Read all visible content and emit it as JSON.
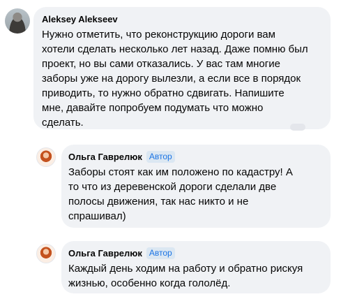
{
  "main_comment": {
    "author": "Aleksey Alekseev",
    "lines": [
      "Нужно отметить, что реконструкцию дороги вам",
      "хотели сделать несколько лет назад. Даже помню был",
      "проект, но вы сами отказались. У вас там многие",
      "заборы уже на дорогу вылезли, а если все в порядок",
      "приводить, то нужно обратно сдвигать. Напишите",
      "мне, давайте попробуем подумать что можно",
      "сделать."
    ]
  },
  "replies": [
    {
      "author": "Ольга Гаврелюк",
      "badge": "Автор",
      "lines": [
        "Заборы стоят как им положено по кадастру! А",
        "то что из деревенской дороги сделали две",
        "полосы движения, так нас никто и не",
        "спрашивал)"
      ]
    },
    {
      "author": "Ольга Гаврелюк",
      "badge": "Автор",
      "lines": [
        "Каждый день ходим на работу и обратно рискуя",
        "жизнью, особенно когда гололёд."
      ]
    }
  ],
  "colors": {
    "bubble_bg": "#f0f2f5",
    "badge_text": "#1b74e4",
    "badge_bg": "#dbe7f2"
  }
}
